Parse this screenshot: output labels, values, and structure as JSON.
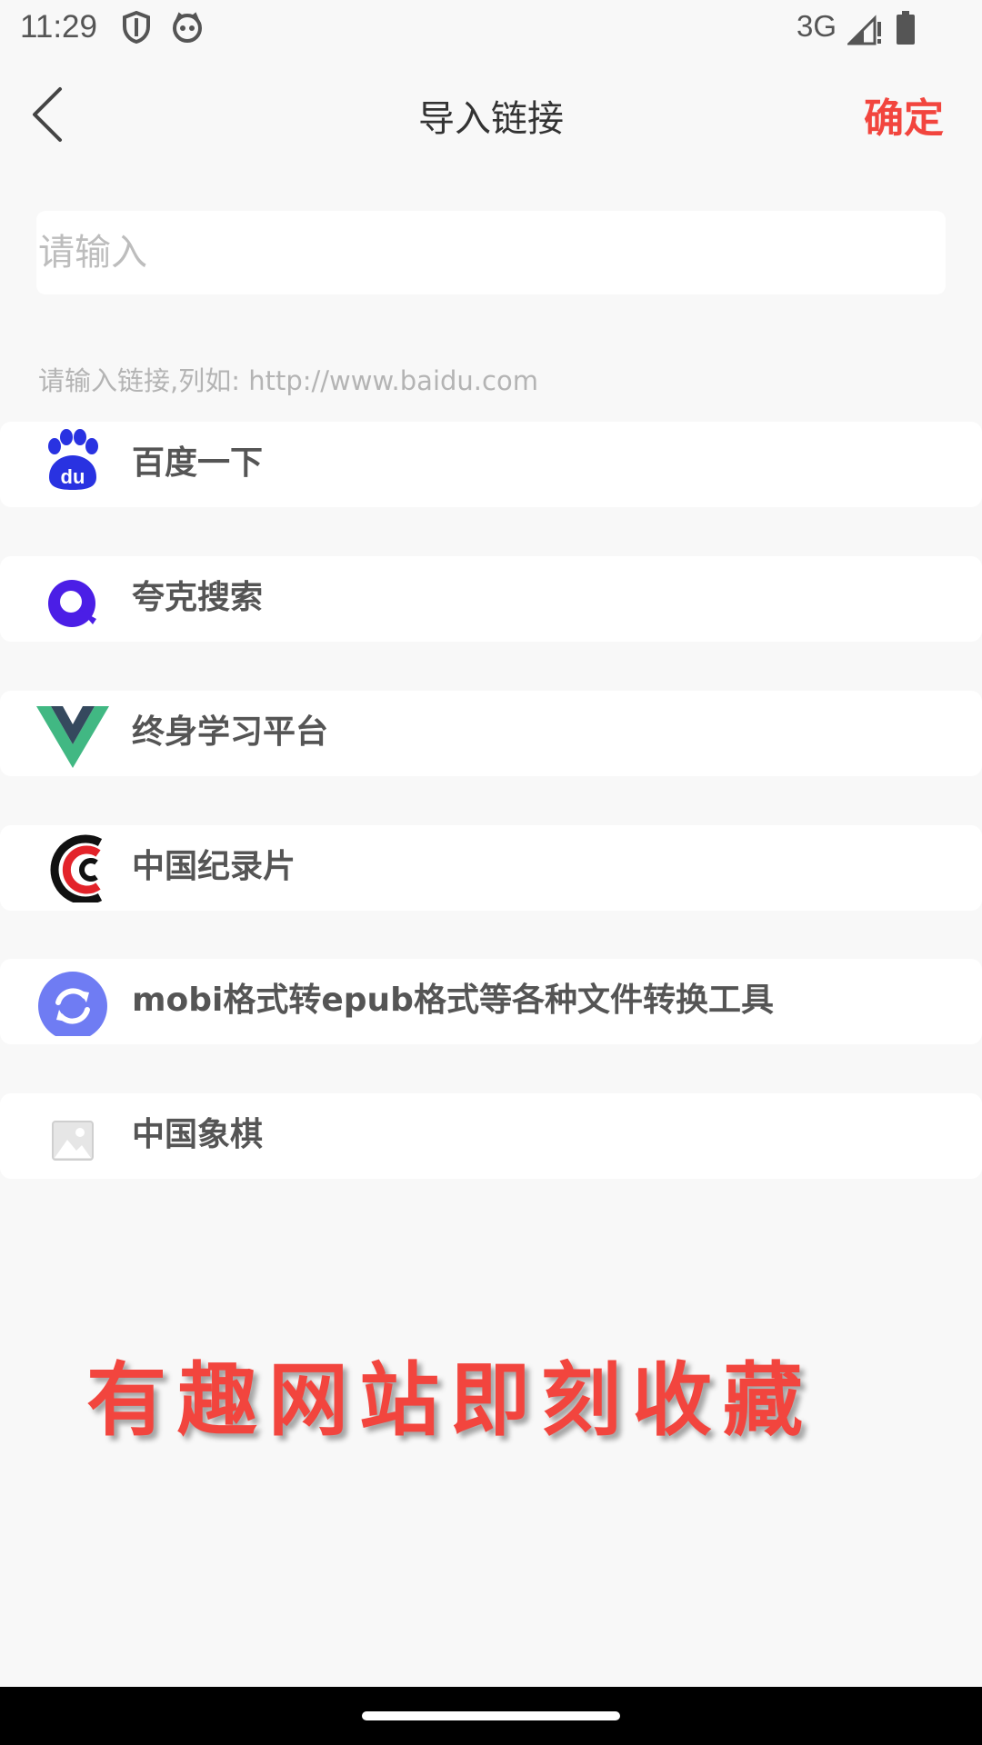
{
  "status_bar": {
    "time": "11:29",
    "network": "3G",
    "icons": [
      "shield-icon",
      "cat-icon",
      "signal-icon",
      "battery-icon"
    ]
  },
  "header": {
    "title": "导入链接",
    "confirm_label": "确定",
    "back_icon": "chevron-left-icon"
  },
  "input": {
    "placeholder": "请输入",
    "value": ""
  },
  "hint": "请输入链接,列如: http://www.baidu.com",
  "sites": [
    {
      "label": "百度一下",
      "icon": "baidu-icon"
    },
    {
      "label": "夸克搜索",
      "icon": "quark-icon"
    },
    {
      "label": "终身学习平台",
      "icon": "vue-icon"
    },
    {
      "label": "中国纪录片",
      "icon": "cctv-icon"
    },
    {
      "label": "mobi格式转epub格式等各种文件转换工具",
      "icon": "convert-icon"
    },
    {
      "label": "中国象棋",
      "icon": "image-placeholder-icon"
    }
  ],
  "promo_text": "有趣网站即刻收藏",
  "colors": {
    "accent": "#f2453e",
    "background": "#f8f8f8",
    "item_background": "#ffffff",
    "baidu_blue": "#2932e1",
    "quark_purple": "#4b1ee6",
    "convert_blue": "#6f7cf3"
  }
}
